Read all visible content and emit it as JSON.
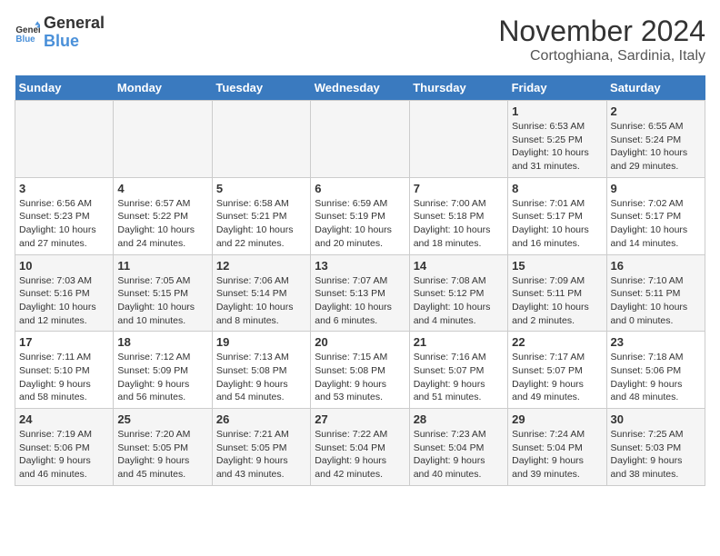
{
  "header": {
    "logo_line1": "General",
    "logo_line2": "Blue",
    "title": "November 2024",
    "subtitle": "Cortoghiana, Sardinia, Italy"
  },
  "weekdays": [
    "Sunday",
    "Monday",
    "Tuesday",
    "Wednesday",
    "Thursday",
    "Friday",
    "Saturday"
  ],
  "weeks": [
    [
      {
        "day": "",
        "info": ""
      },
      {
        "day": "",
        "info": ""
      },
      {
        "day": "",
        "info": ""
      },
      {
        "day": "",
        "info": ""
      },
      {
        "day": "",
        "info": ""
      },
      {
        "day": "1",
        "info": "Sunrise: 6:53 AM\nSunset: 5:25 PM\nDaylight: 10 hours\nand 31 minutes."
      },
      {
        "day": "2",
        "info": "Sunrise: 6:55 AM\nSunset: 5:24 PM\nDaylight: 10 hours\nand 29 minutes."
      }
    ],
    [
      {
        "day": "3",
        "info": "Sunrise: 6:56 AM\nSunset: 5:23 PM\nDaylight: 10 hours\nand 27 minutes."
      },
      {
        "day": "4",
        "info": "Sunrise: 6:57 AM\nSunset: 5:22 PM\nDaylight: 10 hours\nand 24 minutes."
      },
      {
        "day": "5",
        "info": "Sunrise: 6:58 AM\nSunset: 5:21 PM\nDaylight: 10 hours\nand 22 minutes."
      },
      {
        "day": "6",
        "info": "Sunrise: 6:59 AM\nSunset: 5:19 PM\nDaylight: 10 hours\nand 20 minutes."
      },
      {
        "day": "7",
        "info": "Sunrise: 7:00 AM\nSunset: 5:18 PM\nDaylight: 10 hours\nand 18 minutes."
      },
      {
        "day": "8",
        "info": "Sunrise: 7:01 AM\nSunset: 5:17 PM\nDaylight: 10 hours\nand 16 minutes."
      },
      {
        "day": "9",
        "info": "Sunrise: 7:02 AM\nSunset: 5:17 PM\nDaylight: 10 hours\nand 14 minutes."
      }
    ],
    [
      {
        "day": "10",
        "info": "Sunrise: 7:03 AM\nSunset: 5:16 PM\nDaylight: 10 hours\nand 12 minutes."
      },
      {
        "day": "11",
        "info": "Sunrise: 7:05 AM\nSunset: 5:15 PM\nDaylight: 10 hours\nand 10 minutes."
      },
      {
        "day": "12",
        "info": "Sunrise: 7:06 AM\nSunset: 5:14 PM\nDaylight: 10 hours\nand 8 minutes."
      },
      {
        "day": "13",
        "info": "Sunrise: 7:07 AM\nSunset: 5:13 PM\nDaylight: 10 hours\nand 6 minutes."
      },
      {
        "day": "14",
        "info": "Sunrise: 7:08 AM\nSunset: 5:12 PM\nDaylight: 10 hours\nand 4 minutes."
      },
      {
        "day": "15",
        "info": "Sunrise: 7:09 AM\nSunset: 5:11 PM\nDaylight: 10 hours\nand 2 minutes."
      },
      {
        "day": "16",
        "info": "Sunrise: 7:10 AM\nSunset: 5:11 PM\nDaylight: 10 hours\nand 0 minutes."
      }
    ],
    [
      {
        "day": "17",
        "info": "Sunrise: 7:11 AM\nSunset: 5:10 PM\nDaylight: 9 hours\nand 58 minutes."
      },
      {
        "day": "18",
        "info": "Sunrise: 7:12 AM\nSunset: 5:09 PM\nDaylight: 9 hours\nand 56 minutes."
      },
      {
        "day": "19",
        "info": "Sunrise: 7:13 AM\nSunset: 5:08 PM\nDaylight: 9 hours\nand 54 minutes."
      },
      {
        "day": "20",
        "info": "Sunrise: 7:15 AM\nSunset: 5:08 PM\nDaylight: 9 hours\nand 53 minutes."
      },
      {
        "day": "21",
        "info": "Sunrise: 7:16 AM\nSunset: 5:07 PM\nDaylight: 9 hours\nand 51 minutes."
      },
      {
        "day": "22",
        "info": "Sunrise: 7:17 AM\nSunset: 5:07 PM\nDaylight: 9 hours\nand 49 minutes."
      },
      {
        "day": "23",
        "info": "Sunrise: 7:18 AM\nSunset: 5:06 PM\nDaylight: 9 hours\nand 48 minutes."
      }
    ],
    [
      {
        "day": "24",
        "info": "Sunrise: 7:19 AM\nSunset: 5:06 PM\nDaylight: 9 hours\nand 46 minutes."
      },
      {
        "day": "25",
        "info": "Sunrise: 7:20 AM\nSunset: 5:05 PM\nDaylight: 9 hours\nand 45 minutes."
      },
      {
        "day": "26",
        "info": "Sunrise: 7:21 AM\nSunset: 5:05 PM\nDaylight: 9 hours\nand 43 minutes."
      },
      {
        "day": "27",
        "info": "Sunrise: 7:22 AM\nSunset: 5:04 PM\nDaylight: 9 hours\nand 42 minutes."
      },
      {
        "day": "28",
        "info": "Sunrise: 7:23 AM\nSunset: 5:04 PM\nDaylight: 9 hours\nand 40 minutes."
      },
      {
        "day": "29",
        "info": "Sunrise: 7:24 AM\nSunset: 5:04 PM\nDaylight: 9 hours\nand 39 minutes."
      },
      {
        "day": "30",
        "info": "Sunrise: 7:25 AM\nSunset: 5:03 PM\nDaylight: 9 hours\nand 38 minutes."
      }
    ]
  ]
}
